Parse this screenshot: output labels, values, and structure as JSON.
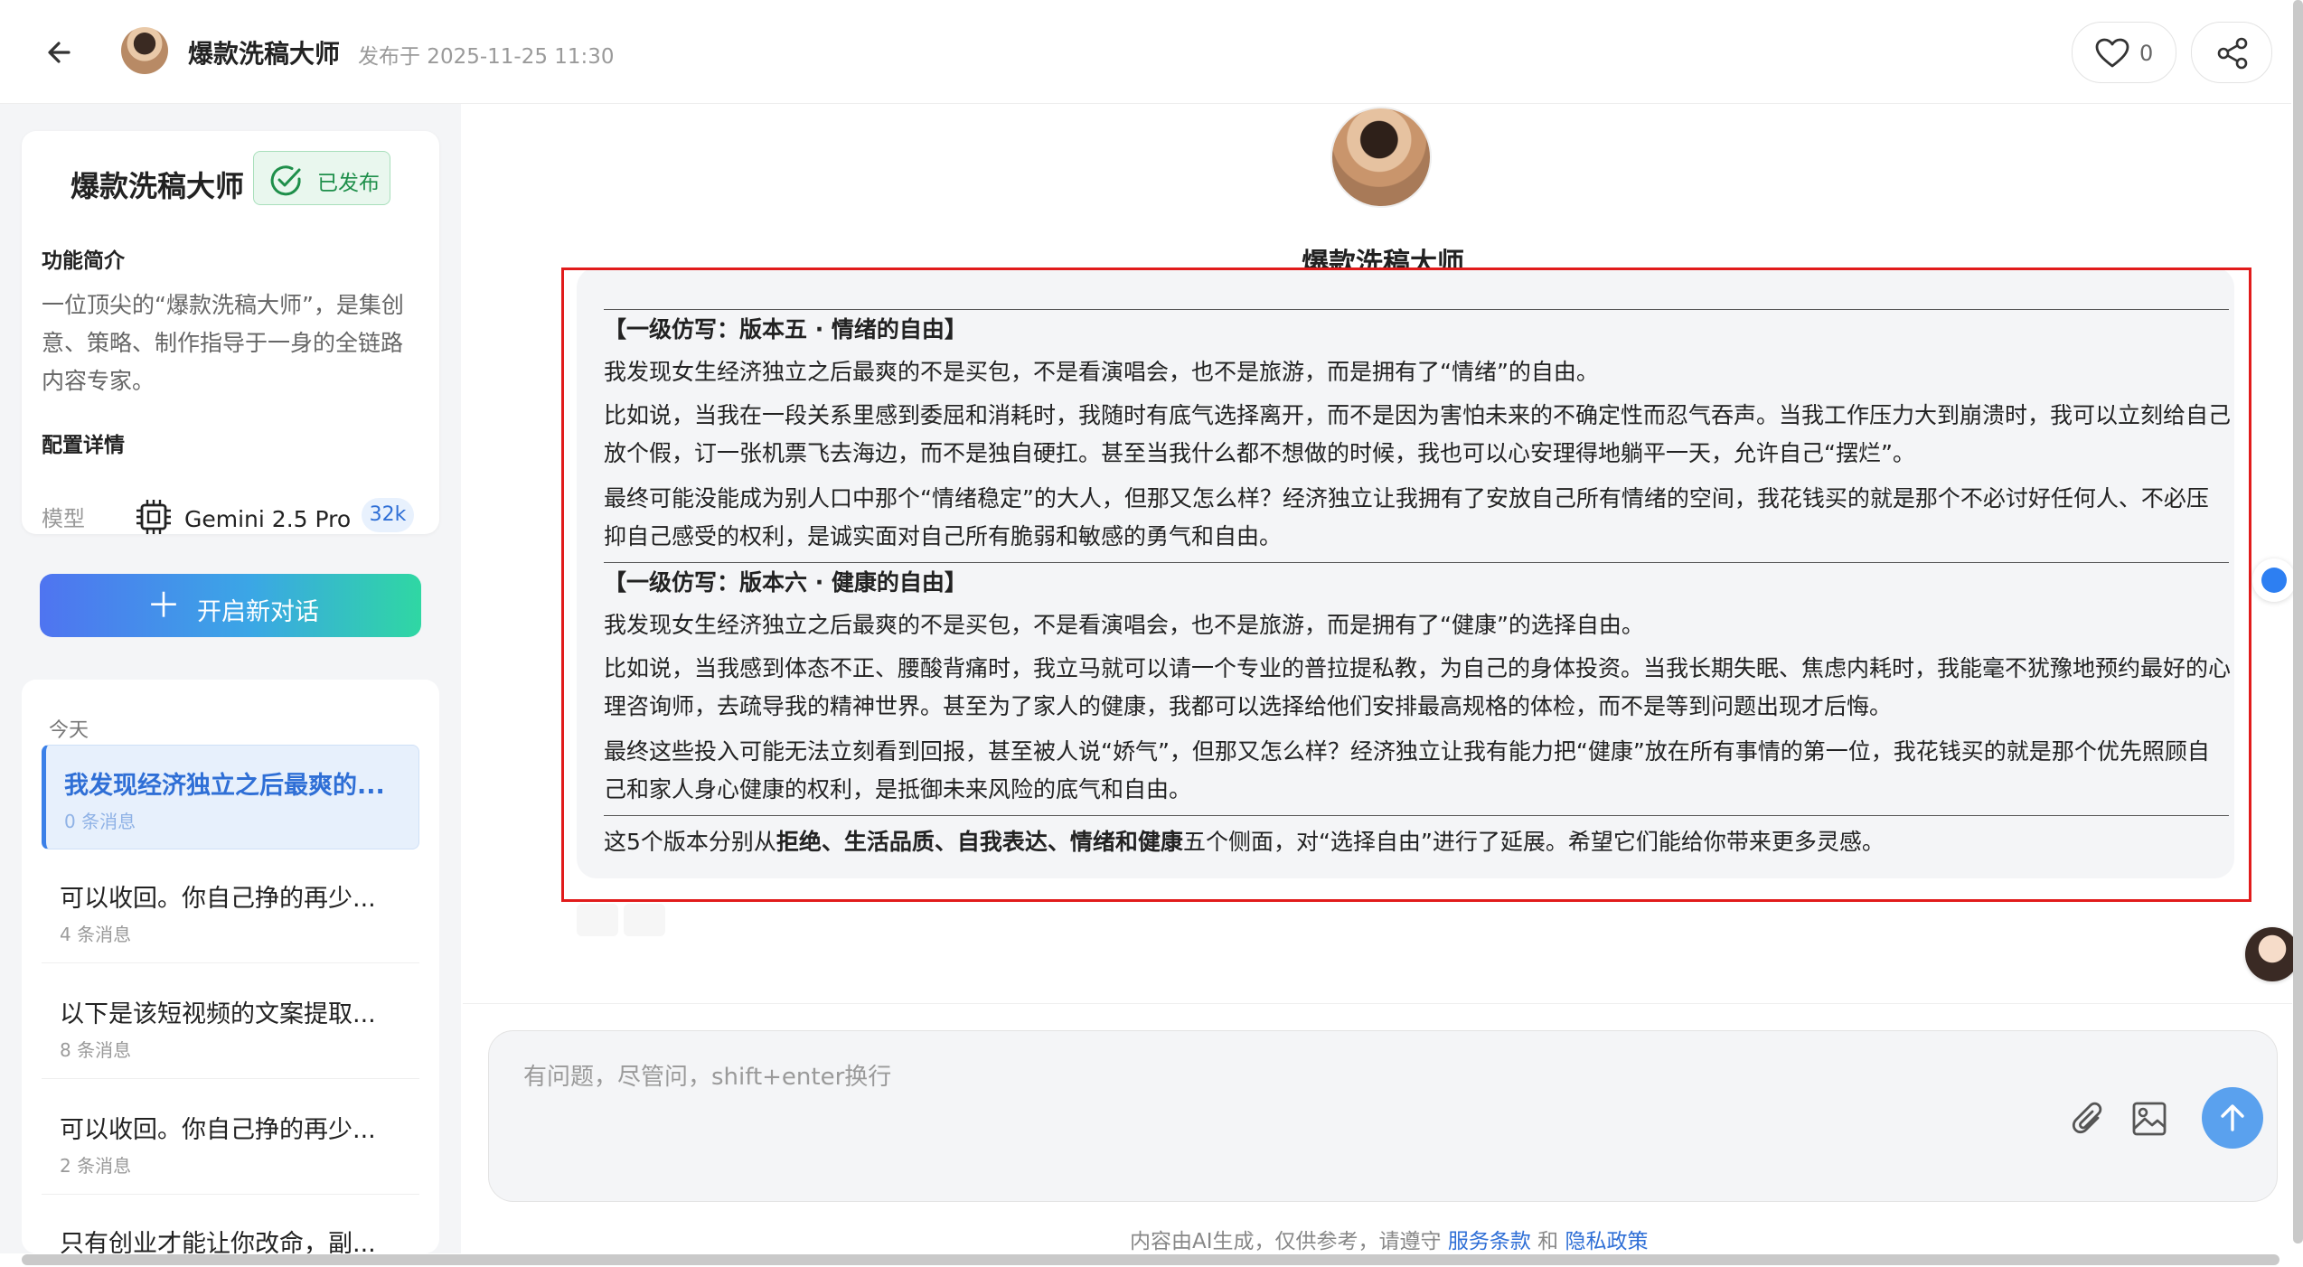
{
  "header": {
    "agent_name": "爆款洗稿大师",
    "published_at": "发布于 2025-11-25 11:30",
    "like_count": "0"
  },
  "sidebar": {
    "card": {
      "name": "爆款洗稿大师",
      "status_badge": "已发布",
      "intro_title": "功能简介",
      "intro_text": "一位顶尖的“爆款洗稿大师”，是集创意、策略、制作指导于一身的全链路内容专家。",
      "config_title": "配置详情",
      "model_label": "模型",
      "model_name": "Gemini 2.5 Pro",
      "context_badge": "32k"
    },
    "new_chat_label": "开启新对话",
    "history_group": "今天",
    "history": [
      {
        "title": "我发现经济独立之后最爽的...",
        "meta": "0 条消息"
      },
      {
        "title": "可以收回。你自己挣的再少...",
        "meta": "4 条消息"
      },
      {
        "title": "以下是该短视频的文案提取...",
        "meta": "8 条消息"
      },
      {
        "title": "可以收回。你自己挣的再少...",
        "meta": "2 条消息"
      },
      {
        "title": "只有创业才能让你改命，副...",
        "meta": ""
      }
    ]
  },
  "chat": {
    "agent_name": "爆款洗稿大师",
    "message": {
      "v5_heading": "【一级仿写：版本五 · 情绪的自由】",
      "v5_p1": "我发现女生经济独立之后最爽的不是买包，不是看演唱会，也不是旅游，而是拥有了“情绪”的自由。",
      "v5_p2": "比如说，当我在一段关系里感到委屈和消耗时，我随时有底气选择离开，而不是因为害怕未来的不确定性而忍气吞声。当我工作压力大到崩溃时，我可以立刻给自己放个假，订一张机票飞去海边，而不是独自硬扛。甚至当我什么都不想做的时候，我也可以心安理得地躺平一天，允许自己“摆烂”。",
      "v5_p3": "最终可能没能成为别人口中那个“情绪稳定”的大人，但那又怎么样？经济独立让我拥有了安放自己所有情绪的空间，我花钱买的就是那个不必讨好任何人、不必压抑自己感受的权利，是诚实面对自己所有脆弱和敏感的勇气和自由。",
      "v6_heading": "【一级仿写：版本六 · 健康的自由】",
      "v6_p1": "我发现女生经济独立之后最爽的不是买包，不是看演唱会，也不是旅游，而是拥有了“健康”的选择自由。",
      "v6_p2": "比如说，当我感到体态不正、腰酸背痛时，我立马就可以请一个专业的普拉提私教，为自己的身体投资。当我长期失眠、焦虑内耗时，我能毫不犹豫地预约最好的心理咨询师，去疏导我的精神世界。甚至为了家人的健康，我都可以选择给他们安排最高规格的体检，而不是等到问题出现才后悔。",
      "v6_p3": "最终这些投入可能无法立刻看到回报，甚至被人说“娇气”，但那又怎么样？经济独立让我有能力把“健康”放在所有事情的第一位，我花钱买的就是那个优先照顾自己和家人身心健康的权利，是抵御未来风险的底气和自由。",
      "summary_pre": "这5个版本分别从",
      "summary_bold": "拒绝、生活品质、自我表达、情绪和健康",
      "summary_post": "五个侧面，对“选择自由”进行了延展。希望它们能给你带来更多灵感。"
    }
  },
  "input": {
    "placeholder": "有问题，尽管问，shift+enter换行"
  },
  "footer": {
    "text": "内容由AI生成，仅供参考，请遵守",
    "terms": "服务条款",
    "and": "和",
    "privacy": "隐私政策"
  },
  "icons": {
    "back": "arrow-left-icon",
    "like": "heart-icon",
    "share": "share-icon",
    "published": "check-circle-icon",
    "model": "chip-icon",
    "attach": "paperclip-icon",
    "image": "image-icon",
    "send": "arrow-up-icon"
  },
  "colors": {
    "accent": "#2f6fd6",
    "published_green": "#1e8f4a",
    "highlight_red": "#e11b1b",
    "send_button": "#5aa1ee"
  }
}
